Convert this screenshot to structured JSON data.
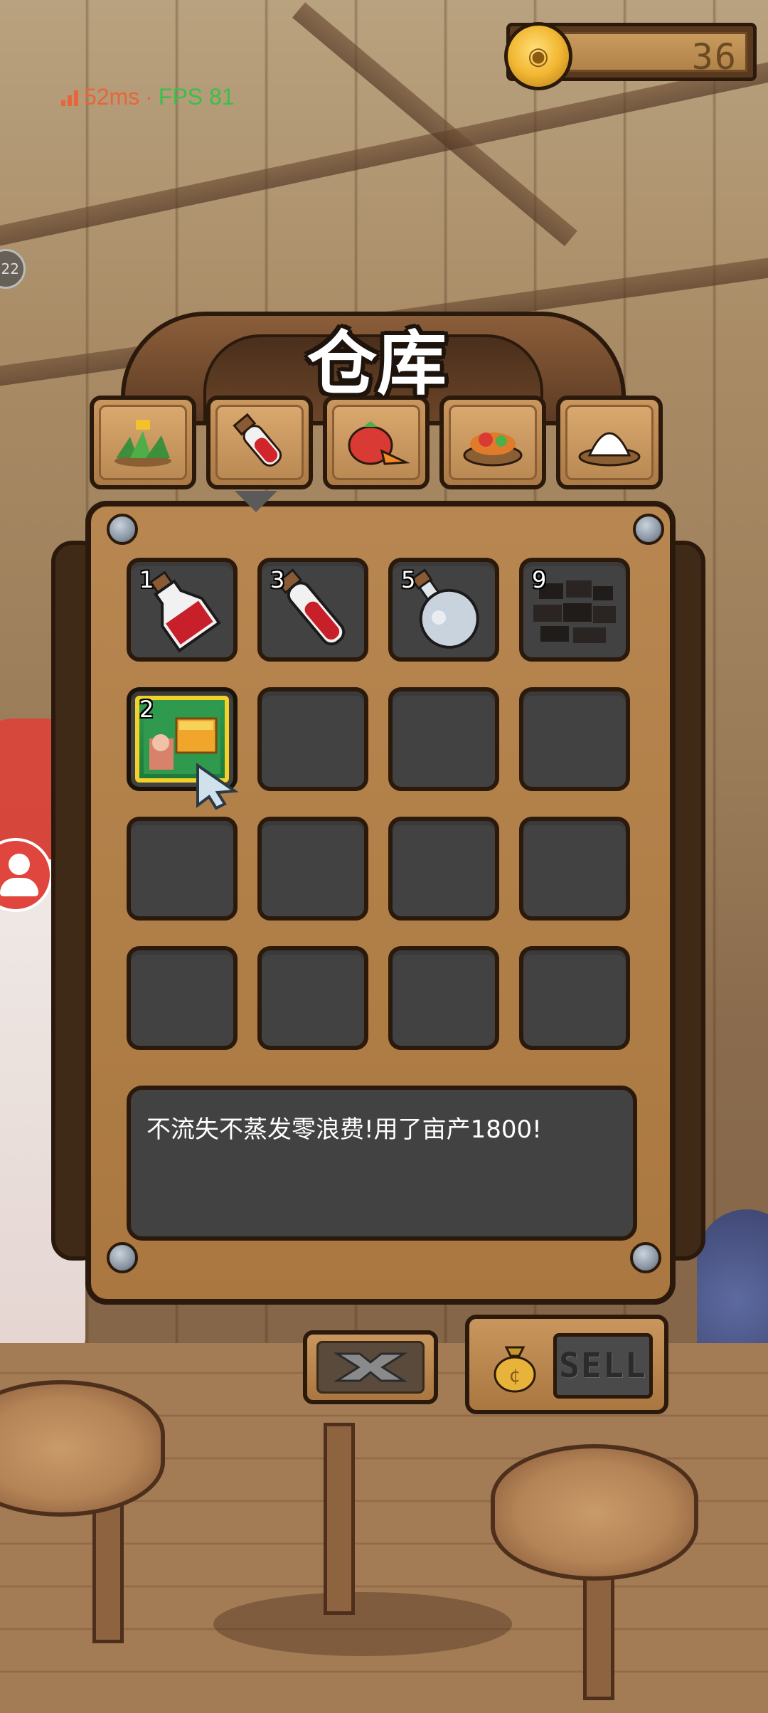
{
  "hud": {
    "coins": "36",
    "latency": "52ms",
    "separator": "·",
    "fps": "FPS 81",
    "left_badge": "22"
  },
  "warehouse": {
    "title": "仓库",
    "tabs": [
      {
        "icon": "herb-icon",
        "selected": false
      },
      {
        "icon": "potion-tube-icon",
        "selected": true
      },
      {
        "icon": "vegetables-icon",
        "selected": false
      },
      {
        "icon": "food-basket-icon",
        "selected": false
      },
      {
        "icon": "rice-bowl-icon",
        "selected": false
      }
    ],
    "slots": [
      {
        "qty": "1",
        "item": "red-potion-flask-icon"
      },
      {
        "qty": "3",
        "item": "red-potion-tube-icon"
      },
      {
        "qty": "5",
        "item": "empty-flask-icon"
      },
      {
        "qty": "9",
        "item": "coal-pile-icon"
      },
      {
        "qty": "2",
        "item": "fertilizer-pack-icon",
        "selected": true
      },
      {},
      {},
      {},
      {},
      {},
      {},
      {},
      {},
      {},
      {},
      {}
    ],
    "description": "不流失不蒸发零浪费!用了亩产1800!"
  },
  "buttons": {
    "sell_label": "SELL"
  },
  "colors": {
    "accent_gold": "#f2d12b",
    "latency_orange": "#e8653c",
    "fps_green": "#38c04a",
    "slot_bg": "#424242",
    "panel_wood": "#b88751"
  }
}
